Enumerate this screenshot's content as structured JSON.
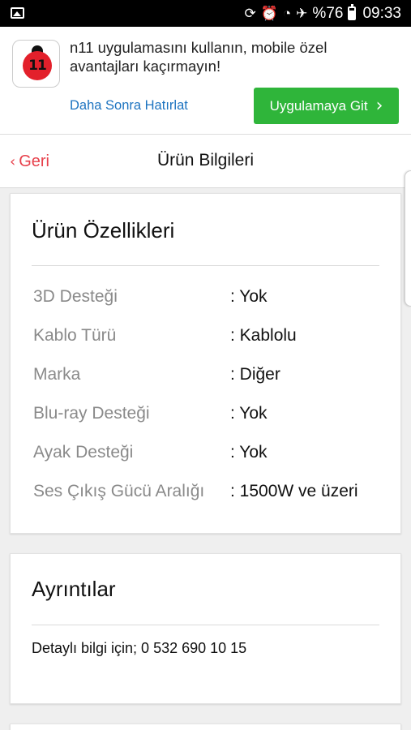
{
  "status_bar": {
    "icons": [
      "image-icon",
      "sync-icon",
      "alarm-icon",
      "wifi-icon",
      "airplane-icon",
      "battery-icon"
    ],
    "battery": "%76",
    "time": "09:33"
  },
  "banner": {
    "logo_text": "11",
    "message": "n11 uygulamasını kullanın, mobile özel avantajları kaçırmayın!",
    "later_label": "Daha Sonra Hatırlat",
    "open_label": "Uygulamaya Git",
    "open_color": "#2fb53a"
  },
  "nav": {
    "back_label": "Geri",
    "title": "Ürün Bilgileri",
    "accent": "#e7404b"
  },
  "features": {
    "title": "Ürün Özellikleri",
    "rows": [
      {
        "key": "3D Desteği",
        "value": ": Yok"
      },
      {
        "key": "Kablo Türü",
        "value": ": Kablolu"
      },
      {
        "key": "Marka",
        "value": ": Diğer"
      },
      {
        "key": "Blu-ray Desteği",
        "value": ": Yok"
      },
      {
        "key": "Ayak Desteği",
        "value": ": Yok"
      },
      {
        "key": "Ses Çıkış Gücü Aralığı",
        "value": ": 1500W ve üzeri"
      }
    ]
  },
  "details": {
    "title": "Ayrıntılar",
    "text": "Detaylı bilgi için; 0 532 690 10 15"
  }
}
